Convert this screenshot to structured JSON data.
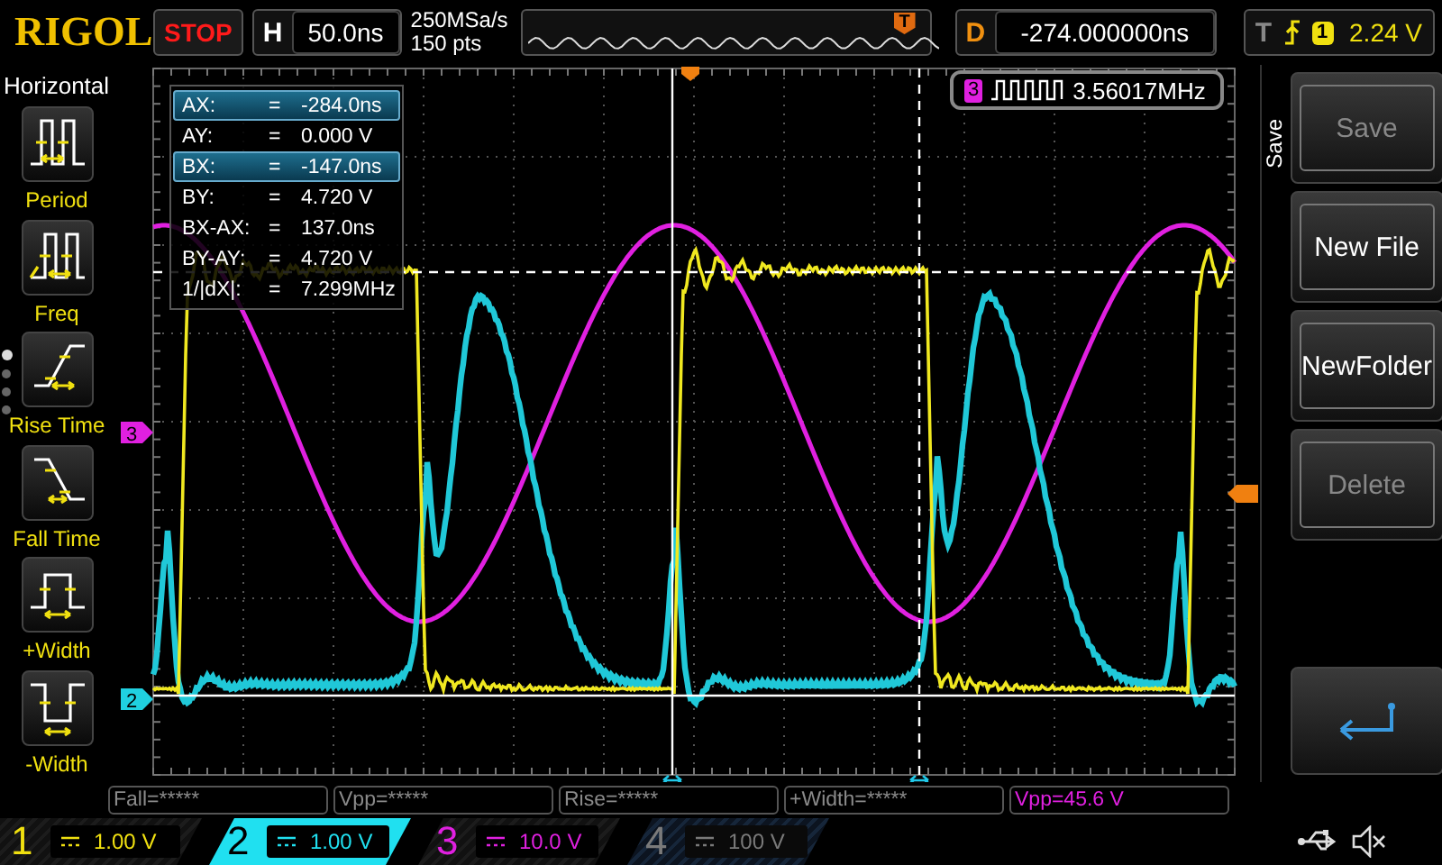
{
  "header": {
    "logo": "RIGOL",
    "run_state": "STOP",
    "timebase": {
      "label": "H",
      "value": "50.0ns"
    },
    "sample_rate": "250MSa/s",
    "memory_depth": "150 pts",
    "overview_marker": "T",
    "delay": {
      "label": "D",
      "value": "-274.000000ns"
    },
    "trigger": {
      "label": "T",
      "source": "1",
      "level": "2.24 V"
    }
  },
  "sidebar": {
    "title": "Horizontal",
    "items": [
      {
        "label": "Period",
        "kind": "period"
      },
      {
        "label": "Freq",
        "kind": "freq"
      },
      {
        "label": "Rise Time",
        "kind": "rise"
      },
      {
        "label": "Fall Time",
        "kind": "fall"
      },
      {
        "label": "+Width",
        "kind": "pwidth"
      },
      {
        "label": "-Width",
        "kind": "nwidth"
      }
    ],
    "pages": [
      {
        "selected": true
      },
      {
        "selected": false
      },
      {
        "selected": false
      },
      {
        "selected": false
      }
    ]
  },
  "cursor_readout": [
    {
      "label": "AX:",
      "eq": "=",
      "value": "-284.0ns",
      "selected": true
    },
    {
      "label": "AY:",
      "eq": "=",
      "value": "0.000 V",
      "selected": false
    },
    {
      "label": "BX:",
      "eq": "=",
      "value": "-147.0ns",
      "selected": true
    },
    {
      "label": "BY:",
      "eq": "=",
      "value": "4.720 V",
      "selected": false
    },
    {
      "label": "BX-AX:",
      "eq": "=",
      "value": "137.0ns",
      "selected": false
    },
    {
      "label": "BY-AY:",
      "eq": "=",
      "value": "4.720 V",
      "selected": false
    },
    {
      "label": "1/|dX|:",
      "eq": "=",
      "value": "7.299MHz",
      "selected": false
    }
  ],
  "frequency_counter": {
    "channel": "3",
    "value": "3.56017MHz"
  },
  "channel_markers": [
    {
      "label": "3",
      "color": "#e020e0"
    },
    {
      "label": "2",
      "color": "#20d0e0"
    }
  ],
  "measurements": [
    {
      "text": "Fall=*****",
      "color": "#8a8a8a"
    },
    {
      "text": "Vpp=*****",
      "color": "#8a8a8a"
    },
    {
      "text": "Rise=*****",
      "color": "#8a8a8a"
    },
    {
      "text": "+Width=*****",
      "color": "#8a8a8a"
    },
    {
      "text": "Vpp=45.6 V",
      "color": "#e020e0"
    }
  ],
  "save_menu": {
    "title": "Save",
    "buttons": [
      {
        "label": "Save",
        "disabled": true
      },
      {
        "label": "New File",
        "disabled": false
      },
      {
        "label": "NewFolder",
        "disabled": false
      },
      {
        "label": "Delete",
        "disabled": true
      }
    ]
  },
  "channels": [
    {
      "number": "1",
      "scale": "1.00 V",
      "color": "#f0e010",
      "selected": false,
      "on": true
    },
    {
      "number": "2",
      "scale": "1.00 V",
      "color": "#20e0f0",
      "selected": true,
      "on": true
    },
    {
      "number": "3",
      "scale": "10.0 V",
      "color": "#e020e0",
      "selected": false,
      "on": true
    },
    {
      "number": "4",
      "scale": "100 V",
      "color": "#7a7a7a",
      "selected": false,
      "on": false
    }
  ]
}
